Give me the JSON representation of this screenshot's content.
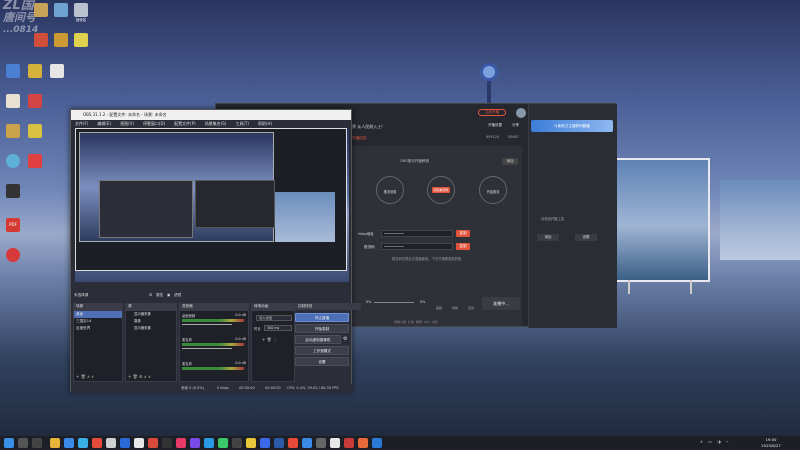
{
  "watermark": {
    "line1": "ZL国",
    "line2": "唐间号",
    "line3": "...0814"
  },
  "desktop_icons": [
    {
      "label": "",
      "color": "#c7a35a"
    },
    {
      "label": "",
      "color": "#6fa3d1"
    },
    {
      "label": "回收站",
      "color": "#b9c1cf"
    },
    {
      "label": "",
      "color": "#d14e3a"
    },
    {
      "label": "",
      "color": "#cc9933"
    },
    {
      "label": "",
      "color": "#e0d050"
    },
    {
      "label": "",
      "color": "#4a7fd4"
    },
    {
      "label": "",
      "color": "#d4b23b"
    },
    {
      "label": "",
      "color": "#e6e6e6"
    },
    {
      "label": "",
      "color": "#d34545"
    },
    {
      "label": "",
      "color": "#e8e0d0"
    },
    {
      "label": "",
      "color": "#caa24c"
    },
    {
      "label": "",
      "color": "#5fb0d8"
    },
    {
      "label": "",
      "color": "#e04040"
    },
    {
      "label": "",
      "color": "#d8c040"
    },
    {
      "label": "",
      "color": "#333333"
    },
    {
      "label": "",
      "color": "#2266cc"
    },
    {
      "label": "PDF",
      "color": "#d43a32"
    },
    {
      "label": "",
      "color": "#d63a3a"
    }
  ],
  "obs": {
    "title": "OBS 31.1.2 - 配置文件: 未命名 - 场景: 未命名",
    "menu": [
      "文件(F)",
      "编辑(E)",
      "视图(V)",
      "停靠窗口(D)",
      "配置文件(P)",
      "场景集合(S)",
      "工具(T)",
      "帮助(H)"
    ],
    "source_bar": {
      "tab1": "属性",
      "tab2": "滤镜"
    },
    "no_source": "未选择源",
    "docks": {
      "scenes": {
        "title": "场景",
        "items": [
          "桌面",
          "三国志14",
          "百度世界"
        ]
      },
      "sources": {
        "title": "源",
        "items": [
          "显示器采集",
          "摄像",
          "显示器采集"
        ]
      },
      "mixer": {
        "title": "混音器",
        "ch1": "桌面音频",
        "ch1_db": "0.0 dB",
        "ch2": "麦克风",
        "ch2_db": "0.0 dB",
        "ch3": "麦克风",
        "ch3_db": "0.0 dB"
      },
      "transitions": {
        "title": "转场动画",
        "mode": "淡入淡出",
        "duration_label": "时长",
        "duration": "300 ms"
      },
      "controls": {
        "title": "控制按钮",
        "stop_stream": "停止直播",
        "start_record": "开始录制",
        "virtual_cam": "启动虚拟摄像机",
        "studio": "工作室模式",
        "settings": "设置"
      }
    },
    "status": {
      "dropped": "丢帧 0 (0.0%)",
      "bitrate": "0 kbps",
      "live": "00:00:00",
      "rec": "00:00:00",
      "cpu": "CPU: 0.4%, 59.02 / 60.00 FPS"
    }
  },
  "sl": {
    "top_btn": "立即开播",
    "link1": "开播设置",
    "link2": "分享",
    "count1": "459124",
    "count2": "55687",
    "world": "动物世界 从人民前入士!",
    "tab": "开播信息",
    "guide_title": "OBS推流开播教程",
    "guide_btn": "添加",
    "steps": [
      {
        "label": "推流设置",
        "sub": ""
      },
      {
        "label": "获取推流码",
        "sub": ""
      },
      {
        "label": "开始推流",
        "sub": ""
      }
    ],
    "rtmp_label": "rtmp地址",
    "rtmp_val": "••••••••••",
    "rtmp_btn": "复制",
    "key_label": "推流码",
    "key_val": "••••••••••",
    "key_btn": "复制",
    "hint": "推流码仅限此次直播使用，下次开播需重新获取",
    "bottom": {
      "a": "0%",
      "b": "0%",
      "end": "准播中...",
      "icons": [
        "音量",
        "美颜",
        "特效",
        "互动",
        "更多"
      ]
    },
    "side_banner": "斗鱼助力主播获利翻番",
    "side_text1": "请添加开播工具",
    "side_btn1": "添加",
    "side_btn2": "设置",
    "stats": [
      "观看人数",
      "礼物",
      "弹幕",
      "CPU",
      "内存"
    ]
  },
  "taskbar": {
    "time": "19:00",
    "date": "2025/8/27"
  }
}
